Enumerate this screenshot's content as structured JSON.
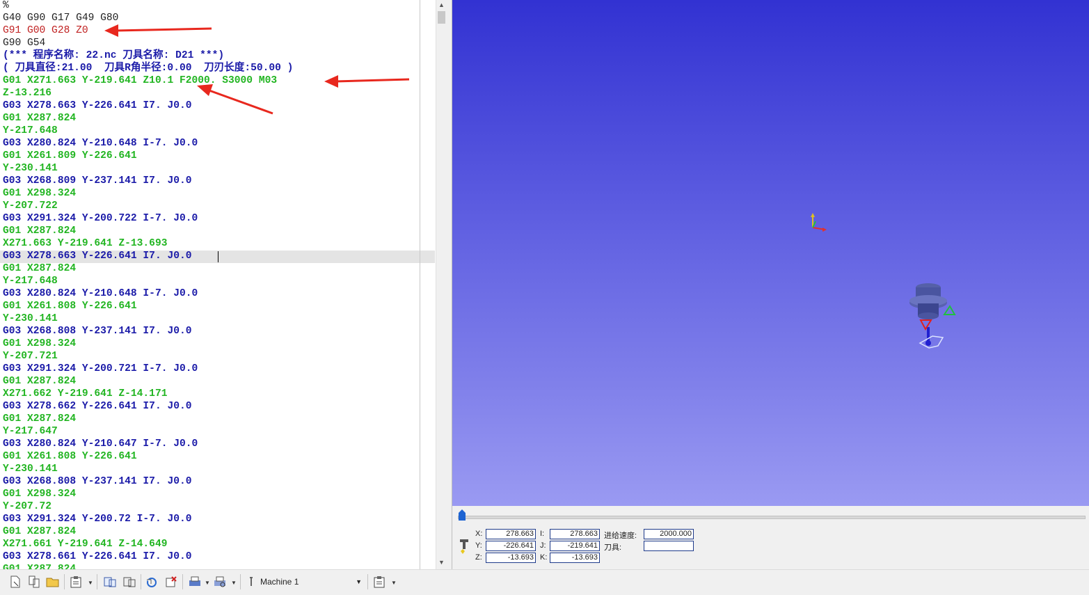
{
  "editor": {
    "lines": [
      {
        "text": "%",
        "color": "black"
      },
      {
        "text": "G40 G90 G17 G49 G80",
        "color": "black"
      },
      {
        "text": "G91 G00 G28 Z0",
        "color": "red"
      },
      {
        "text": "G90 G54",
        "color": "black"
      },
      {
        "text": "(*** 程序名称: 22.nc 刀具名称: D21 ***)",
        "color": "blue"
      },
      {
        "text": "( 刀具直径:21.00  刀具R角半径:0.00  刀刃长度:50.00 )",
        "color": "blue"
      },
      {
        "text": "G01 X271.663 Y-219.641 Z10.1 F2000. S3000 M03",
        "color": "green"
      },
      {
        "text": "Z-13.216",
        "color": "green"
      },
      {
        "text": "G03 X278.663 Y-226.641 I7. J0.0",
        "color": "blue"
      },
      {
        "text": "G01 X287.824",
        "color": "green"
      },
      {
        "text": "Y-217.648",
        "color": "green"
      },
      {
        "text": "G03 X280.824 Y-210.648 I-7. J0.0",
        "color": "blue"
      },
      {
        "text": "G01 X261.809 Y-226.641",
        "color": "green"
      },
      {
        "text": "Y-230.141",
        "color": "green"
      },
      {
        "text": "G03 X268.809 Y-237.141 I7. J0.0",
        "color": "blue"
      },
      {
        "text": "G01 X298.324",
        "color": "green"
      },
      {
        "text": "Y-207.722",
        "color": "green"
      },
      {
        "text": "G03 X291.324 Y-200.722 I-7. J0.0",
        "color": "blue"
      },
      {
        "text": "G01 X287.824",
        "color": "green"
      },
      {
        "text": "X271.663 Y-219.641 Z-13.693",
        "color": "green"
      },
      {
        "text": "G03 X278.663 Y-226.641 I7. J0.0",
        "color": "blue"
      },
      {
        "text": "G01 X287.824",
        "color": "green"
      },
      {
        "text": "Y-217.648",
        "color": "green"
      },
      {
        "text": "G03 X280.824 Y-210.648 I-7. J0.0",
        "color": "blue"
      },
      {
        "text": "G01 X261.808 Y-226.641",
        "color": "green"
      },
      {
        "text": "Y-230.141",
        "color": "green"
      },
      {
        "text": "G03 X268.808 Y-237.141 I7. J0.0",
        "color": "blue"
      },
      {
        "text": "G01 X298.324",
        "color": "green"
      },
      {
        "text": "Y-207.721",
        "color": "green"
      },
      {
        "text": "G03 X291.324 Y-200.721 I-7. J0.0",
        "color": "blue"
      },
      {
        "text": "G01 X287.824",
        "color": "green"
      },
      {
        "text": "X271.662 Y-219.641 Z-14.171",
        "color": "green"
      },
      {
        "text": "G03 X278.662 Y-226.641 I7. J0.0",
        "color": "blue"
      },
      {
        "text": "G01 X287.824",
        "color": "green"
      },
      {
        "text": "Y-217.647",
        "color": "green"
      },
      {
        "text": "G03 X280.824 Y-210.647 I-7. J0.0",
        "color": "blue"
      },
      {
        "text": "G01 X261.808 Y-226.641",
        "color": "green"
      },
      {
        "text": "Y-230.141",
        "color": "green"
      },
      {
        "text": "G03 X268.808 Y-237.141 I7. J0.0",
        "color": "blue"
      },
      {
        "text": "G01 X298.324",
        "color": "green"
      },
      {
        "text": "Y-207.72",
        "color": "green"
      },
      {
        "text": "G03 X291.324 Y-200.72 I-7. J0.0",
        "color": "blue"
      },
      {
        "text": "G01 X287.824",
        "color": "green"
      },
      {
        "text": "X271.661 Y-219.641 Z-14.649",
        "color": "green"
      },
      {
        "text": "G03 X278.661 Y-226.641 I7. J0.0",
        "color": "blue"
      },
      {
        "text": "G01 X287.824",
        "color": "green"
      }
    ]
  },
  "colors": {
    "black": "#202020",
    "red": "#c02020",
    "blue": "#1a1aa8",
    "green": "#22b522",
    "annotation_arrow": "#e8281e"
  },
  "status": {
    "x_label": "X:",
    "x_value": "278.663",
    "y_label": "Y:",
    "y_value": "-226.641",
    "z_label": "Z:",
    "z_value": "-13.693",
    "i_label": "I:",
    "i_value": "278.663",
    "j_label": "J:",
    "j_value": "-219.641",
    "k_label": "K:",
    "k_value": "-13.693",
    "feed_label": "进给速度:",
    "feed_value": "2000.000",
    "tool_label": "刀具:",
    "tool_value": ""
  },
  "toolbar": {
    "machine_select": "Machine 1"
  }
}
